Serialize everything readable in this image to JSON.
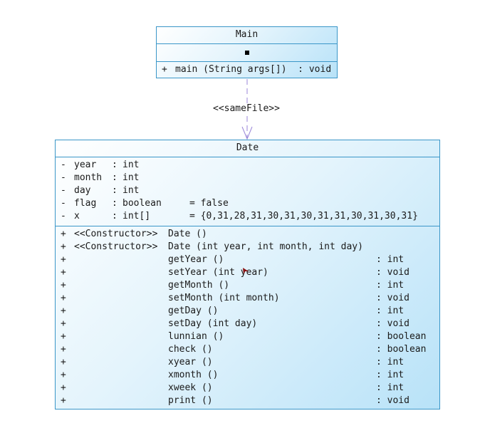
{
  "diagram": {
    "main_class": {
      "name": "Main",
      "operations": [
        {
          "visibility": "+",
          "signature": "main (String args[])  : void"
        }
      ]
    },
    "relationship": {
      "label": "<<sameFile>>"
    },
    "date_class": {
      "name": "Date",
      "attributes": [
        {
          "visibility": "-",
          "name": "year",
          "colon": ":",
          "type": "int",
          "default": ""
        },
        {
          "visibility": "-",
          "name": "month",
          "colon": ":",
          "type": "int",
          "default": ""
        },
        {
          "visibility": "-",
          "name": "day",
          "colon": ":",
          "type": "int",
          "default": ""
        },
        {
          "visibility": "-",
          "name": "flag",
          "colon": ":",
          "type": "boolean",
          "default": "= false"
        },
        {
          "visibility": "-",
          "name": "x",
          "colon": ":",
          "type": "int[]",
          "default": "= {0,31,28,31,30,31,30,31,31,30,31,30,31}"
        }
      ],
      "operations": [
        {
          "visibility": "+",
          "stereotype": "<<Constructor>>",
          "signature": "Date ()",
          "return": ""
        },
        {
          "visibility": "+",
          "stereotype": "<<Constructor>>",
          "signature": "Date (int year, int month, int day)",
          "return": ""
        },
        {
          "visibility": "+",
          "stereotype": "",
          "signature": "getYear ()",
          "return": ": int"
        },
        {
          "visibility": "+",
          "stereotype": "",
          "signature": "setYear (int year)",
          "return": ": void"
        },
        {
          "visibility": "+",
          "stereotype": "",
          "signature": "getMonth ()",
          "return": ": int"
        },
        {
          "visibility": "+",
          "stereotype": "",
          "signature": "setMonth (int month)",
          "return": ": void"
        },
        {
          "visibility": "+",
          "stereotype": "",
          "signature": "getDay ()",
          "return": ": int"
        },
        {
          "visibility": "+",
          "stereotype": "",
          "signature": "setDay (int day)",
          "return": ": void"
        },
        {
          "visibility": "+",
          "stereotype": "",
          "signature": "lunnian ()",
          "return": ": boolean"
        },
        {
          "visibility": "+",
          "stereotype": "",
          "signature": "check ()",
          "return": ": boolean"
        },
        {
          "visibility": "+",
          "stereotype": "",
          "signature": "xyear ()",
          "return": ": int"
        },
        {
          "visibility": "+",
          "stereotype": "",
          "signature": "xmonth ()",
          "return": ": int"
        },
        {
          "visibility": "+",
          "stereotype": "",
          "signature": "xweek ()",
          "return": ": int"
        },
        {
          "visibility": "+",
          "stereotype": "",
          "signature": "print ()",
          "return": ": void"
        }
      ]
    }
  },
  "colors": {
    "class_border": "#3a96c8",
    "dependency_line": "#9a86d8"
  }
}
